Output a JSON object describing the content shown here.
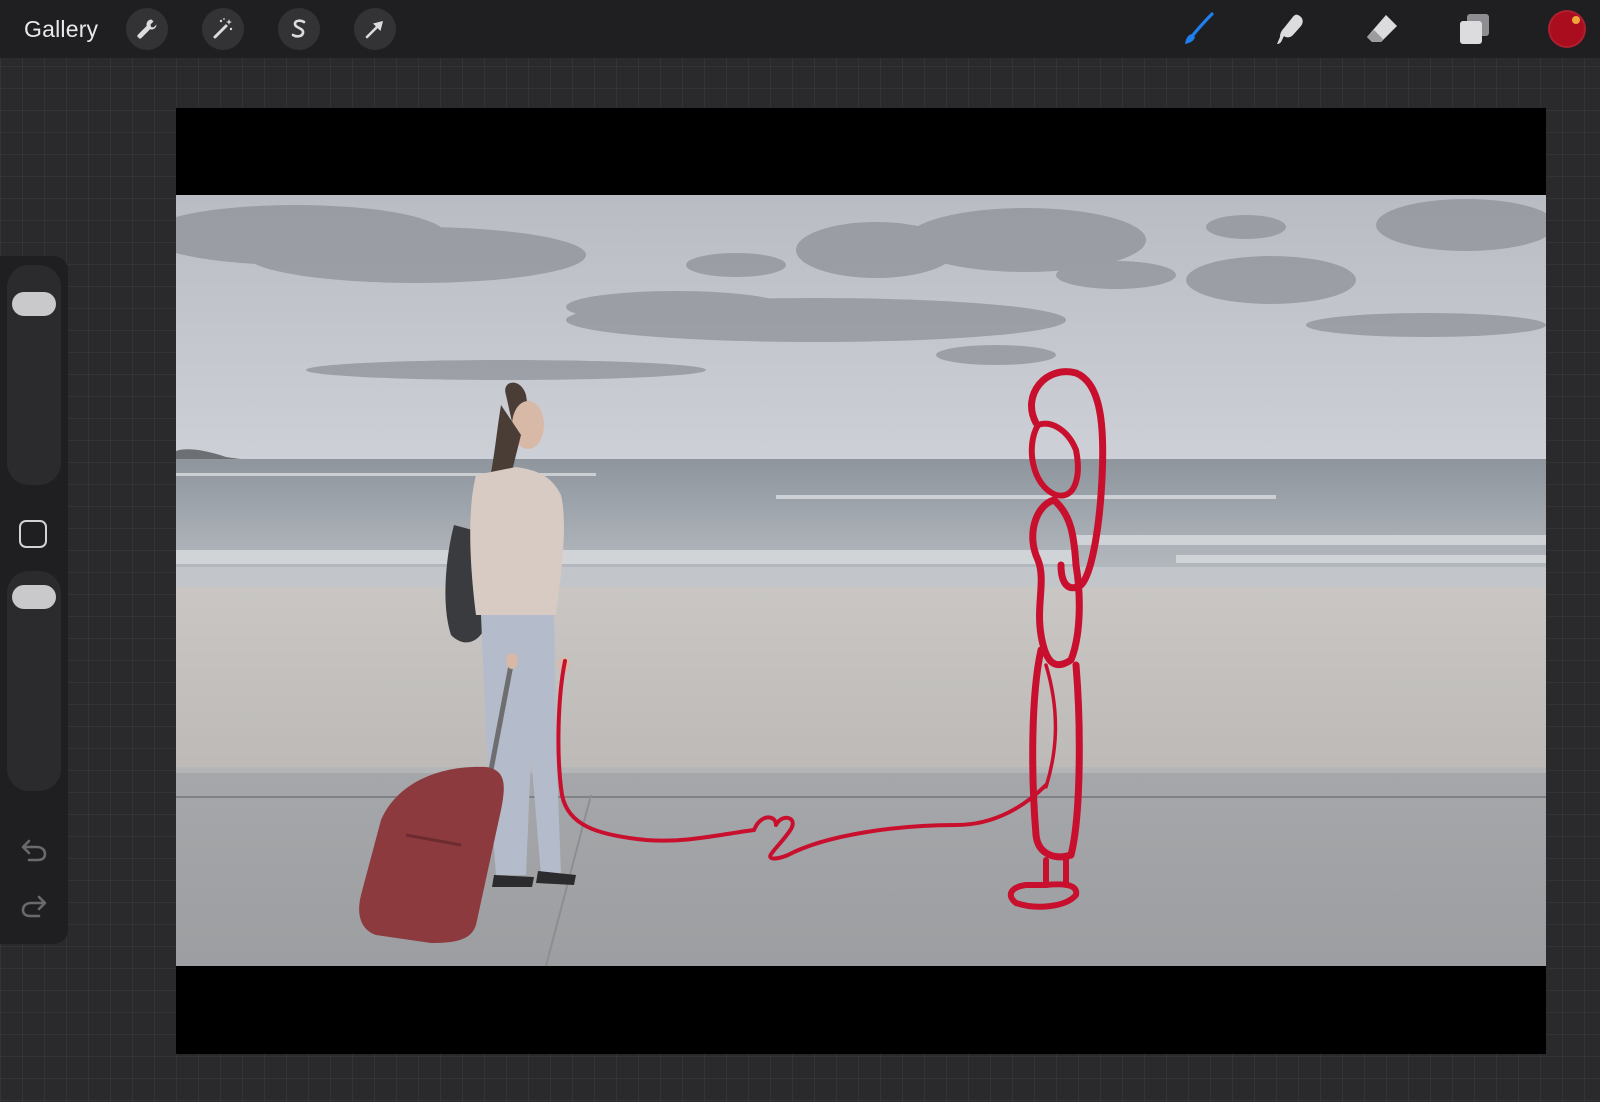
{
  "app": {
    "gallery_label": "Gallery"
  },
  "toolbar_left": [
    {
      "name": "actions-button",
      "icon": "wrench-icon"
    },
    {
      "name": "adjustments-button",
      "icon": "magic-wand-icon"
    },
    {
      "name": "selection-button",
      "icon": "selection-s-icon"
    },
    {
      "name": "transform-button",
      "icon": "arrow-cursor-icon"
    }
  ],
  "toolbar_right": [
    {
      "name": "brush-tool",
      "icon": "brush-icon",
      "active": true
    },
    {
      "name": "smudge-tool",
      "icon": "smudge-finger-icon",
      "active": false
    },
    {
      "name": "eraser-tool",
      "icon": "eraser-icon",
      "active": false
    },
    {
      "name": "layers-button",
      "icon": "layers-icon",
      "active": false
    }
  ],
  "colors": {
    "toolbar_bg": "#1f1f21",
    "workspace_bg": "#2a2a2c",
    "active_tool": "#1f7ef0",
    "current_color": "#a90d1e",
    "stroke_red": "#c8102e"
  },
  "sidebar": {
    "brush_size_level": 0.88,
    "brush_opacity_level": 0.95,
    "modify_icon": "square-modify-icon",
    "undo_icon": "undo-arrow-icon",
    "redo_icon": "redo-arrow-icon"
  }
}
